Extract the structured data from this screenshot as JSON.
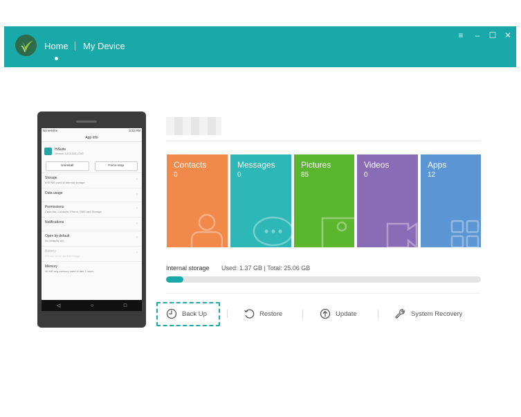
{
  "header": {
    "home_label": "Home",
    "device_label": "My Device",
    "window_controls": [
      "≡",
      "–",
      "☐",
      "✕"
    ]
  },
  "phone": {
    "status_left": "No service",
    "status_right": "3:22 PM",
    "screen_title": "App info",
    "app_name": "HiSuite",
    "app_version": "Version 5.0.3.300_OVE",
    "uninstall_label": "Uninstall",
    "force_stop_label": "Force stop",
    "rows": [
      {
        "title": "Storage",
        "sub": "6.03 MB used in internal storage"
      },
      {
        "title": "Data usage",
        "sub": ""
      },
      {
        "title": "Permissions",
        "sub": "Calendar, Contacts, Phone, SMS and Storage"
      },
      {
        "title": "Notifications",
        "sub": ""
      },
      {
        "title": "Open by default",
        "sub": "No defaults set"
      },
      {
        "title": "Battery",
        "sub": "0% use since last full charge"
      },
      {
        "title": "Memory",
        "sub": "40 MB avg memory used in last 3 hours"
      }
    ]
  },
  "tiles": [
    {
      "label": "Contacts",
      "count": "0",
      "color": "#f0894a"
    },
    {
      "label": "Messages",
      "count": "0",
      "color": "#2db7b7"
    },
    {
      "label": "Pictures",
      "count": "85",
      "color": "#5ab52f"
    },
    {
      "label": "Videos",
      "count": "0",
      "color": "#8a6bb5"
    },
    {
      "label": "Apps",
      "count": "12",
      "color": "#5b95d3"
    }
  ],
  "storage": {
    "label": "Internal storage",
    "info": "Used: 1.37 GB | Total: 25.06 GB",
    "used_fraction": 0.055
  },
  "actions": {
    "backup": "Back Up",
    "restore": "Restore",
    "update": "Update",
    "recovery": "System Recovery"
  },
  "colors": {
    "accent": "#1aa9a9"
  }
}
